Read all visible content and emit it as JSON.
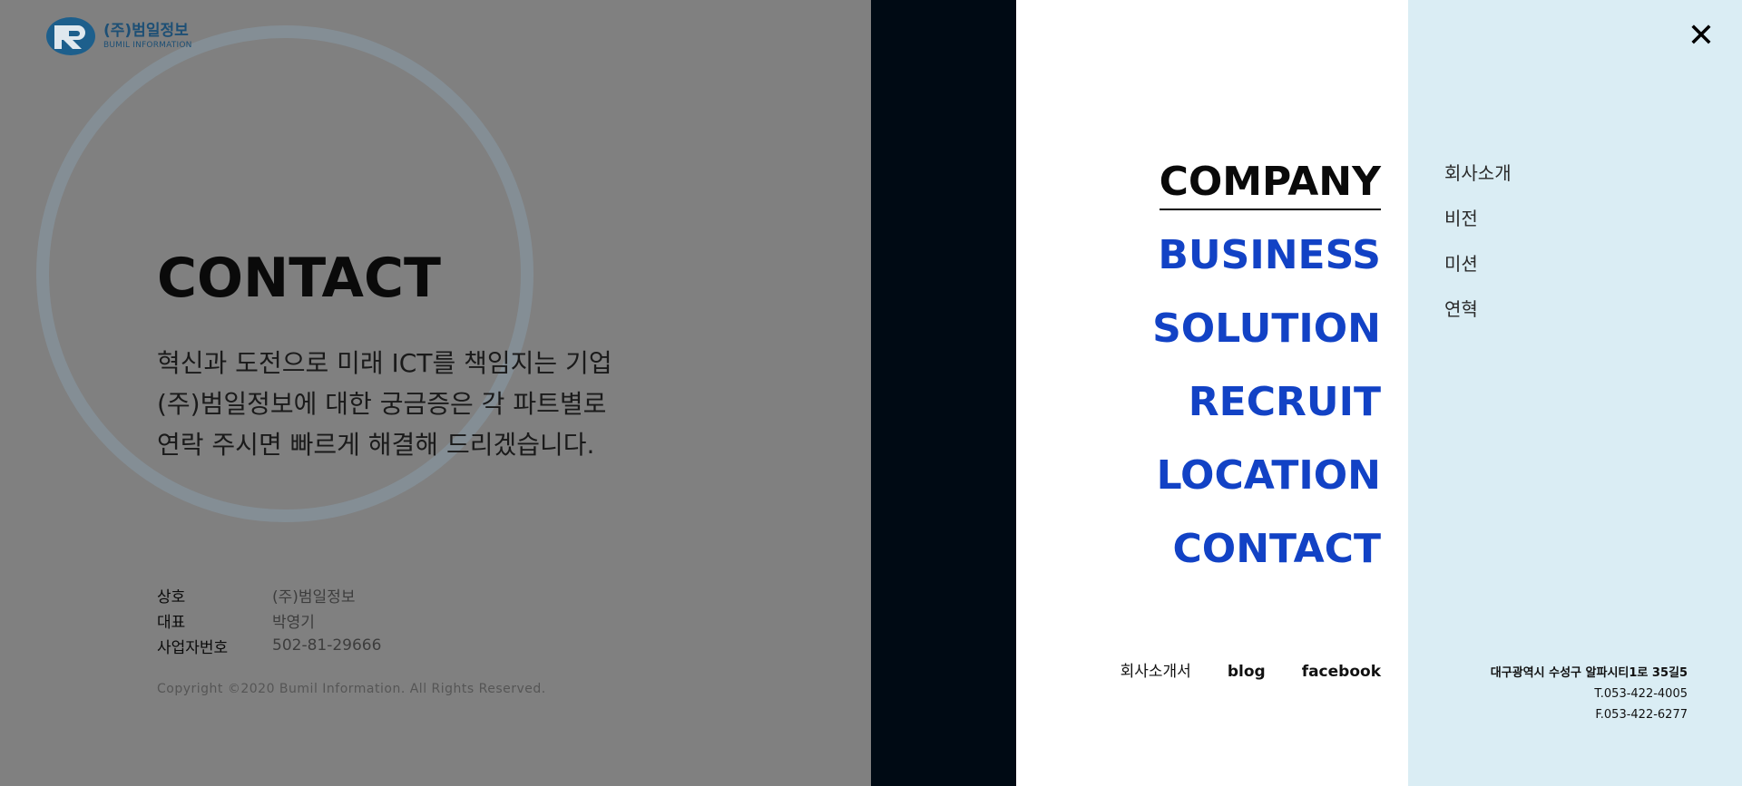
{
  "logo": {
    "korean": "(주)범일정보",
    "english": "BUMIL INFORMATION"
  },
  "hero": {
    "title": "CONTACT",
    "desc_lines": [
      "혁신과 도전으로 미래 ICT를 책임지는 기업",
      "(주)범일정보에 대한 궁금증은 각 파트별로",
      "연락 주시면 빠르게 해결해 드리겠습니다."
    ]
  },
  "company_info": [
    {
      "label": "상호",
      "value": "(주)범일정보"
    },
    {
      "label": "대표",
      "value": "박영기"
    },
    {
      "label": "사업자번호",
      "value": "502-81-29666"
    }
  ],
  "copyright": "Copyright ©2020 Bumil Information. All Rights Reserved.",
  "menu": {
    "items": [
      {
        "label": "COMPANY",
        "active": true
      },
      {
        "label": "BUSINESS",
        "active": false
      },
      {
        "label": "SOLUTION",
        "active": false
      },
      {
        "label": "RECRUIT",
        "active": false
      },
      {
        "label": "LOCATION",
        "active": false
      },
      {
        "label": "CONTACT",
        "active": false
      }
    ],
    "bottom_links": [
      "회사소개서",
      "blog",
      "facebook"
    ],
    "close_label": "✕"
  },
  "submenu": [
    "회사소개",
    "비전",
    "미션",
    "연혁"
  ],
  "address": {
    "line1": "대구광역시 수성구 알파시티1로 35길5",
    "tel": "T.053-422-4005",
    "fax": "F.053-422-6277"
  },
  "colors": {
    "overlay": "#808080",
    "dark_band": "#000a14",
    "menu_blue": "#1242c5",
    "submenu_bg": "#daedf4",
    "logo_blue": "#1d4f75"
  }
}
